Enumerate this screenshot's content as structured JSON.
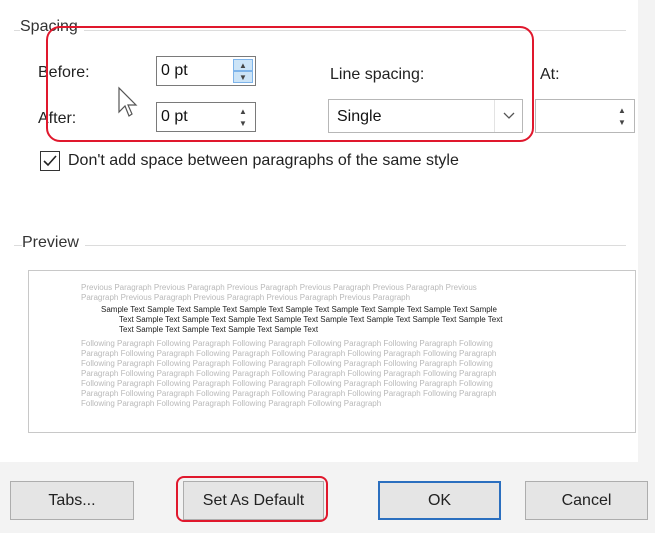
{
  "spacing": {
    "group_label": "Spacing",
    "before_label": "Before:",
    "before_value": "0 pt",
    "after_label": "After:",
    "after_value": "0 pt",
    "line_spacing_label": "Line spacing:",
    "line_spacing_value": "Single",
    "at_label": "At:",
    "at_value": ""
  },
  "checkbox": {
    "label": "Don't add space between paragraphs of the same style",
    "checked": true
  },
  "preview": {
    "label": "Preview",
    "lines": [
      {
        "kind": "prev",
        "text": "Previous Paragraph Previous Paragraph Previous Paragraph Previous Paragraph Previous Paragraph Previous"
      },
      {
        "kind": "prev",
        "text": "Paragraph Previous Paragraph Previous Paragraph Previous Paragraph Previous Paragraph"
      },
      {
        "kind": "sample",
        "text": "Sample Text Sample Text Sample Text Sample Text Sample Text Sample Text Sample Text Sample Text Sample"
      },
      {
        "kind": "sample",
        "text": "Text Sample Text Sample Text Sample Text Sample Text Sample Text Sample Text Sample Text Sample Text"
      },
      {
        "kind": "sample",
        "text": "Text Sample Text Sample Text Sample Text Sample Text"
      },
      {
        "kind": "follow",
        "text": "Following Paragraph Following Paragraph Following Paragraph Following Paragraph Following Paragraph Following"
      },
      {
        "kind": "follow",
        "text": "Paragraph Following Paragraph Following Paragraph Following Paragraph Following Paragraph Following Paragraph"
      },
      {
        "kind": "follow",
        "text": "Following Paragraph Following Paragraph Following Paragraph Following Paragraph Following Paragraph Following"
      },
      {
        "kind": "follow",
        "text": "Paragraph Following Paragraph Following Paragraph Following Paragraph Following Paragraph Following Paragraph"
      },
      {
        "kind": "follow",
        "text": "Following Paragraph Following Paragraph Following Paragraph Following Paragraph Following Paragraph Following"
      },
      {
        "kind": "follow",
        "text": "Paragraph Following Paragraph Following Paragraph Following Paragraph Following Paragraph Following Paragraph"
      },
      {
        "kind": "follow",
        "text": "Following Paragraph Following Paragraph Following Paragraph Following Paragraph"
      }
    ]
  },
  "buttons": {
    "tabs": "Tabs...",
    "set_default": "Set As Default",
    "ok": "OK",
    "cancel": "Cancel"
  },
  "icons": {
    "spin_up": "spin-up-icon",
    "spin_down": "spin-down-icon",
    "dropdown": "chevron-down-icon",
    "cursor": "mouse-pointer-icon",
    "check": "checkmark-icon"
  },
  "colors": {
    "annotation": "#e0182d",
    "ok_border": "#2b6fbf",
    "spin_highlight": "#cce4f7"
  }
}
